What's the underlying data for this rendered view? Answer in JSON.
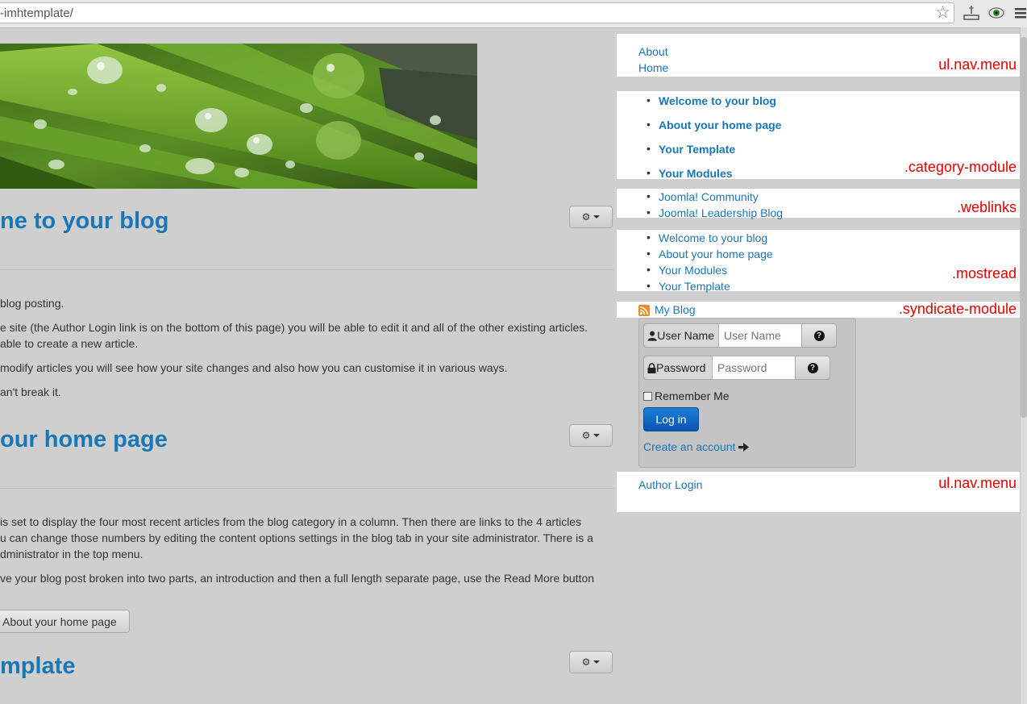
{
  "browser": {
    "url_text": "-imhtemplate/",
    "bookmark_icon": "star-icon",
    "toolbar_icons": [
      "download-icon",
      "eye-icon",
      "menu-icon"
    ]
  },
  "articles": [
    {
      "title": "ne to your blog",
      "paragraphs": [
        "blog posting.",
        "e site (the Author Login link is on the bottom of this page) you will be able to edit it and all of the other existing articles.",
        "able to create a new article.",
        "modify articles you will see how your site changes and also how you can customise it in various ways.",
        "an't break it."
      ]
    },
    {
      "title": "our home page",
      "paragraphs": [
        "is set to display the four most recent articles from the blog category in a column. Then there are links to the 4 articles",
        "u can change those numbers by editing the content options settings in the blog tab in your site administrator. There is a",
        "dministrator in the top menu.",
        "ve your blog post broken into two parts, an introduction and then a full length separate page, use the Read More button"
      ],
      "readmore_label": "About your home page"
    },
    {
      "title": "mplate"
    }
  ],
  "sidebar": {
    "nav_menu": {
      "items": [
        "About",
        "Home"
      ],
      "label": "ul.nav.menu"
    },
    "category_module": {
      "items": [
        "Welcome to your blog",
        "About your home page",
        "Your Template",
        "Your Modules"
      ],
      "label": ".category-module"
    },
    "weblinks": {
      "items": [
        "Joomla! Community",
        "Joomla! Leadership Blog"
      ],
      "label": ".weblinks"
    },
    "mostread": {
      "items": [
        "Welcome to your blog",
        "About your home page",
        "Your Modules",
        "Your Template"
      ],
      "label": ".mostread"
    },
    "syndicate": {
      "link": "My Blog",
      "label": ".syndicate-module"
    },
    "login": {
      "username_label": "User Name",
      "username_placeholder": "User Name",
      "password_label": "Password",
      "password_placeholder": "Password",
      "remember_label": "Remember Me",
      "login_button": "Log in",
      "create_account": "Create an account"
    },
    "footer_menu": {
      "items": [
        "Author Login"
      ],
      "label": "ul.nav.menu"
    }
  },
  "colors": {
    "link": "#1a77b5",
    "annotation": "#e00000",
    "page_bg": "#cfcfcf"
  }
}
